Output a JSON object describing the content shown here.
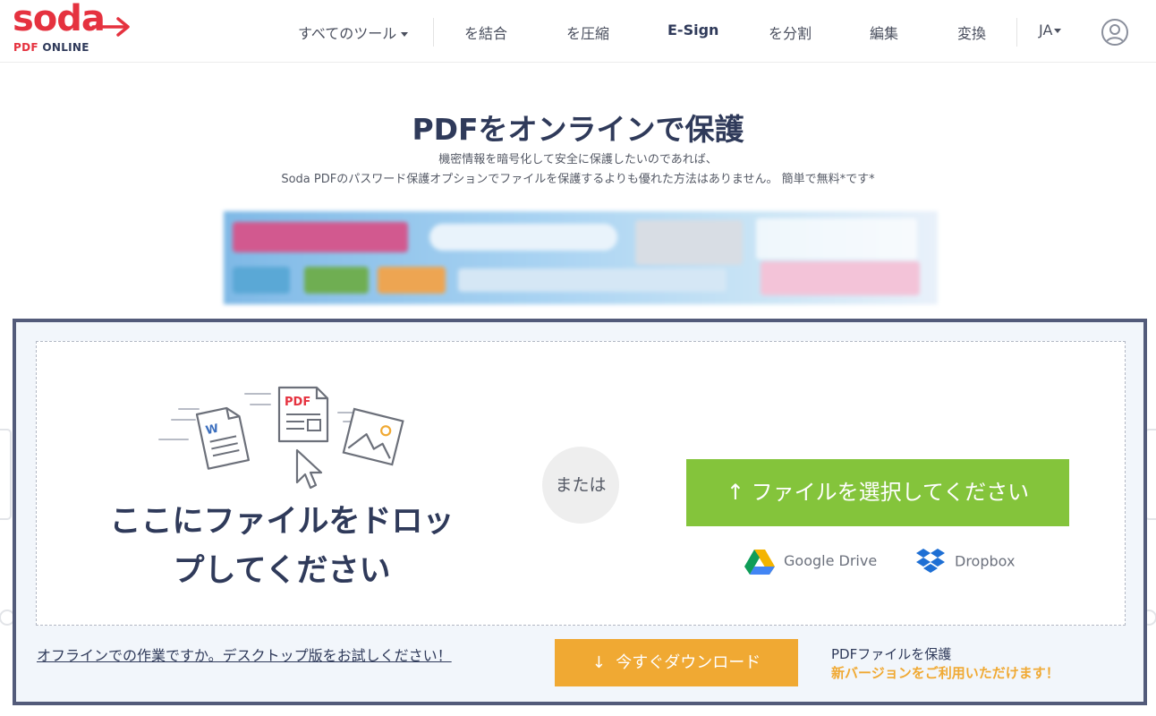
{
  "brand": {
    "name": "soda",
    "sub_red": "PDF",
    "sub_dark": "ONLINE",
    "color": "#e5323f"
  },
  "nav": {
    "all_tools": "すべてのツール",
    "merge": "を結合",
    "compress": "を圧縮",
    "esign": "E-Sign",
    "split": "を分割",
    "edit": "編集",
    "convert": "変換",
    "language": "JA"
  },
  "hero": {
    "title": "PDFをオンラインで保護",
    "subtitle_1": "機密情報を暗号化して安全に保護したいのであれば、",
    "subtitle_2": "Soda PDFのパスワード保護オプションでファイルを保護するよりも優れた方法はありません。 簡単で無料*です*"
  },
  "upload": {
    "drop_text_1": "ここにファイルをドロッ",
    "drop_text_2": "プしてください",
    "or": "または",
    "choose_arrow": "↑",
    "choose_label": "ファイルを選択してください",
    "google_drive": "Google Drive",
    "dropbox": "Dropbox",
    "icons": [
      "word-document-icon",
      "pdf-document-icon",
      "image-file-icon",
      "cursor-icon"
    ]
  },
  "footer": {
    "offline_link": "オフラインでの作業ですか。デスクトップ版をお試しください！",
    "download_arrow": "↓",
    "download_label": "今すぐダウンロード",
    "protect_label": "PDFファイルを保護",
    "new_version": "新バージョンをご利用いただけます！"
  },
  "colors": {
    "primary_text": "#2f3a5a",
    "green": "#84c43b",
    "orange": "#f0a933",
    "frame": "#535b7a"
  }
}
